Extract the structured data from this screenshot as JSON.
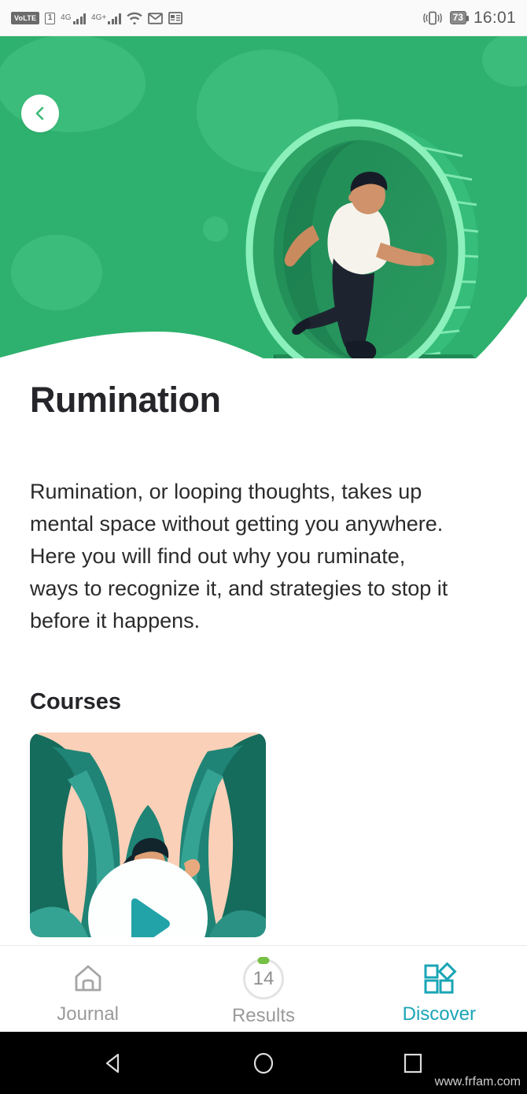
{
  "status_bar": {
    "volte_label": "VoLTE",
    "sim_label": "1",
    "network_1": "4G",
    "network_2": "4G+",
    "battery_percent": "73",
    "time": "16:01",
    "icons": [
      "volte-badge",
      "sim-card-icon",
      "signal-bars-icon",
      "signal-bars-icon",
      "wifi-icon",
      "gmail-icon",
      "news-icon",
      "vibrate-icon",
      "battery-icon"
    ]
  },
  "hero": {
    "back_icon": "chevron-left-icon",
    "illustration": "person-running-in-hamster-wheel",
    "bg_color": "#2eb16e",
    "blob_color": "#3cbc7b",
    "wheel_rim_color": "#7ff0b4",
    "wheel_inner_color": "#1f8a55"
  },
  "page": {
    "title": "Rumination",
    "description": "Rumination, or looping thoughts, takes up mental space without getting you anywhere. Here you will find out why you ruminate, ways to recognize it, and strategies to stop it before it happens.",
    "courses_heading": "Courses"
  },
  "course_card": {
    "illustration": "woman-reclining-among-leaves",
    "play_icon": "play-icon",
    "play_color": "#22a3a8",
    "bg_peach": "#fbd0b8",
    "leaf_dark": "#156b5c",
    "leaf_mid": "#1f8476",
    "leaf_light": "#35a394"
  },
  "bottom_nav": {
    "accent_color": "#19a5b5",
    "inactive_color": "#9a9a9a",
    "items": [
      {
        "label": "Journal",
        "icon": "home-icon",
        "active": false
      },
      {
        "label": "Results",
        "icon": "results-count-ring",
        "badge": "14",
        "dot": true,
        "active": false
      },
      {
        "label": "Discover",
        "icon": "grid-diamond-icon",
        "active": true
      }
    ]
  },
  "system_nav": {
    "back": "triangle-back-icon",
    "home": "circle-home-icon",
    "recents": "square-recents-icon",
    "watermark": "www.frfam.com"
  }
}
